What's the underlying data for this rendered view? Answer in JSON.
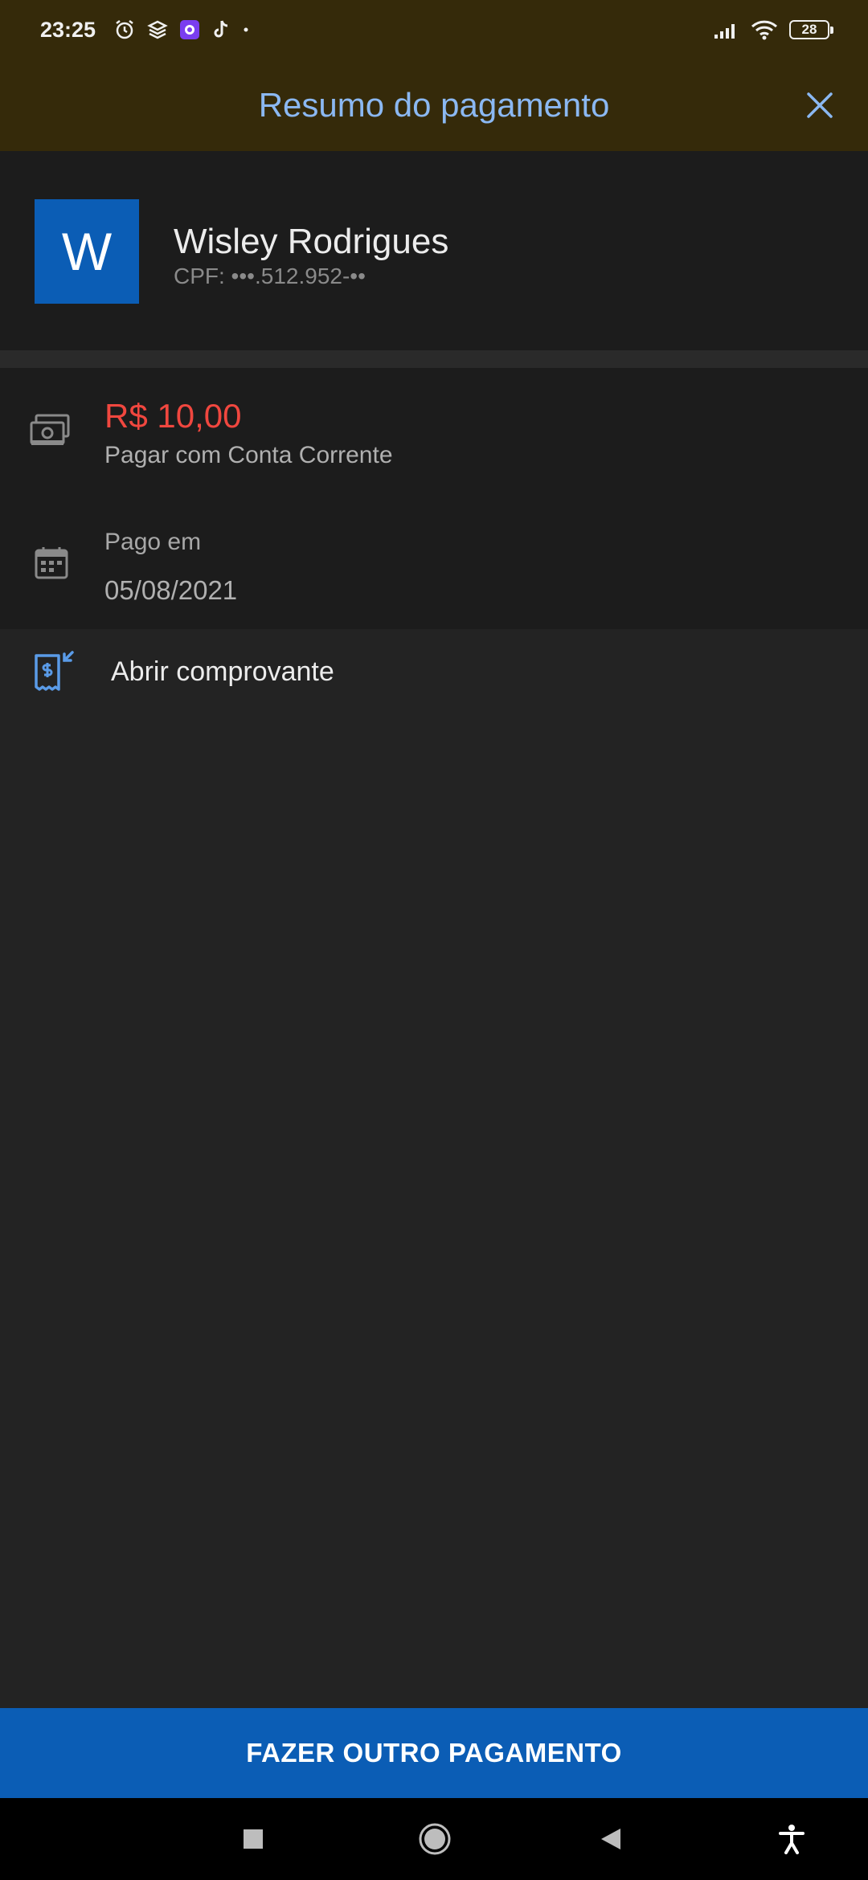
{
  "status_bar": {
    "time": "23:25",
    "battery": "28",
    "icons_left": [
      "alarm-icon",
      "layers-icon",
      "app-badge-icon",
      "tiktok-icon",
      "dot-icon"
    ],
    "icons_right": [
      "signal-icon",
      "wifi-icon",
      "battery-icon"
    ]
  },
  "header": {
    "title": "Resumo do pagamento",
    "close_icon": "close-icon"
  },
  "payee": {
    "initial": "W",
    "name": "Wisley Rodrigues",
    "cpf": "CPF: •••.512.952-••"
  },
  "payment": {
    "amount": "R$ 10,00",
    "method": "Pagar com Conta Corrente",
    "paid_label": "Pago em",
    "paid_date": "05/08/2021"
  },
  "receipt": {
    "label": "Abrir comprovante"
  },
  "cta": {
    "label": "FAZER OUTRO PAGAMENTO"
  },
  "colors": {
    "header_bg": "#352a0a",
    "accent_blue": "#0b5db5",
    "title_blue": "#8bb8f2",
    "amount_red": "#f0473f"
  }
}
